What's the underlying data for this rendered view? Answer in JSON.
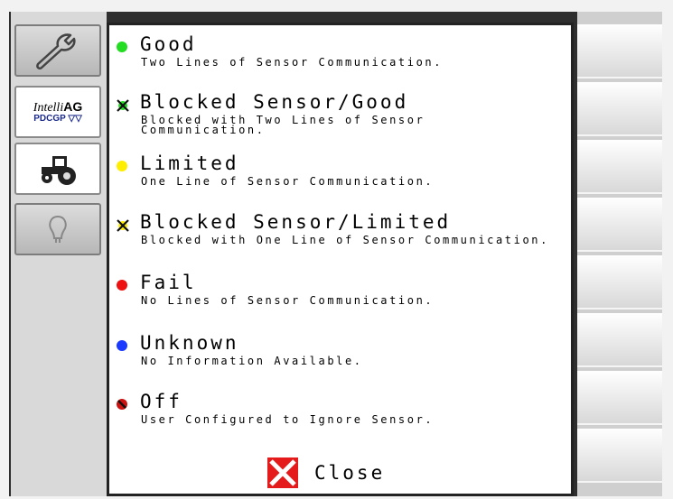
{
  "sidebar": {
    "buttons": [
      {
        "icon": "wrench-icon"
      },
      {
        "icon": "intelliag-logo",
        "logo_line1": "Intelli",
        "logo_line1b": "AG",
        "logo_line2": "PDCGP ▽▽"
      },
      {
        "icon": "tractor-icon"
      },
      {
        "icon": "bulb-outline-icon"
      }
    ]
  },
  "legend": {
    "items": [
      {
        "title": "Good",
        "description": "Two Lines of Sensor Communication.",
        "color": "#22dd22",
        "marker": "dot"
      },
      {
        "title": "Blocked Sensor/Good",
        "description": "Blocked with Two Lines of Sensor Communication.",
        "color": "#22dd22",
        "marker": "x"
      },
      {
        "title": "Limited",
        "description": "One Line of Sensor Communication.",
        "color": "#ffee00",
        "marker": "dot"
      },
      {
        "title": "Blocked Sensor/Limited",
        "description": "Blocked with One Line of Sensor Communication.",
        "color": "#ffee00",
        "marker": "x"
      },
      {
        "title": "Fail",
        "description": "No Lines of Sensor Communication.",
        "color": "#ee1111",
        "marker": "dot"
      },
      {
        "title": "Unknown",
        "description": "No Information Available.",
        "color": "#1a3aff",
        "marker": "dot"
      },
      {
        "title": "Off",
        "description": "User Configured to Ignore Sensor.",
        "color": "#cc1111",
        "marker": "off"
      }
    ]
  },
  "close_button": {
    "label": "Close",
    "icon_color": "#e51a1a"
  }
}
